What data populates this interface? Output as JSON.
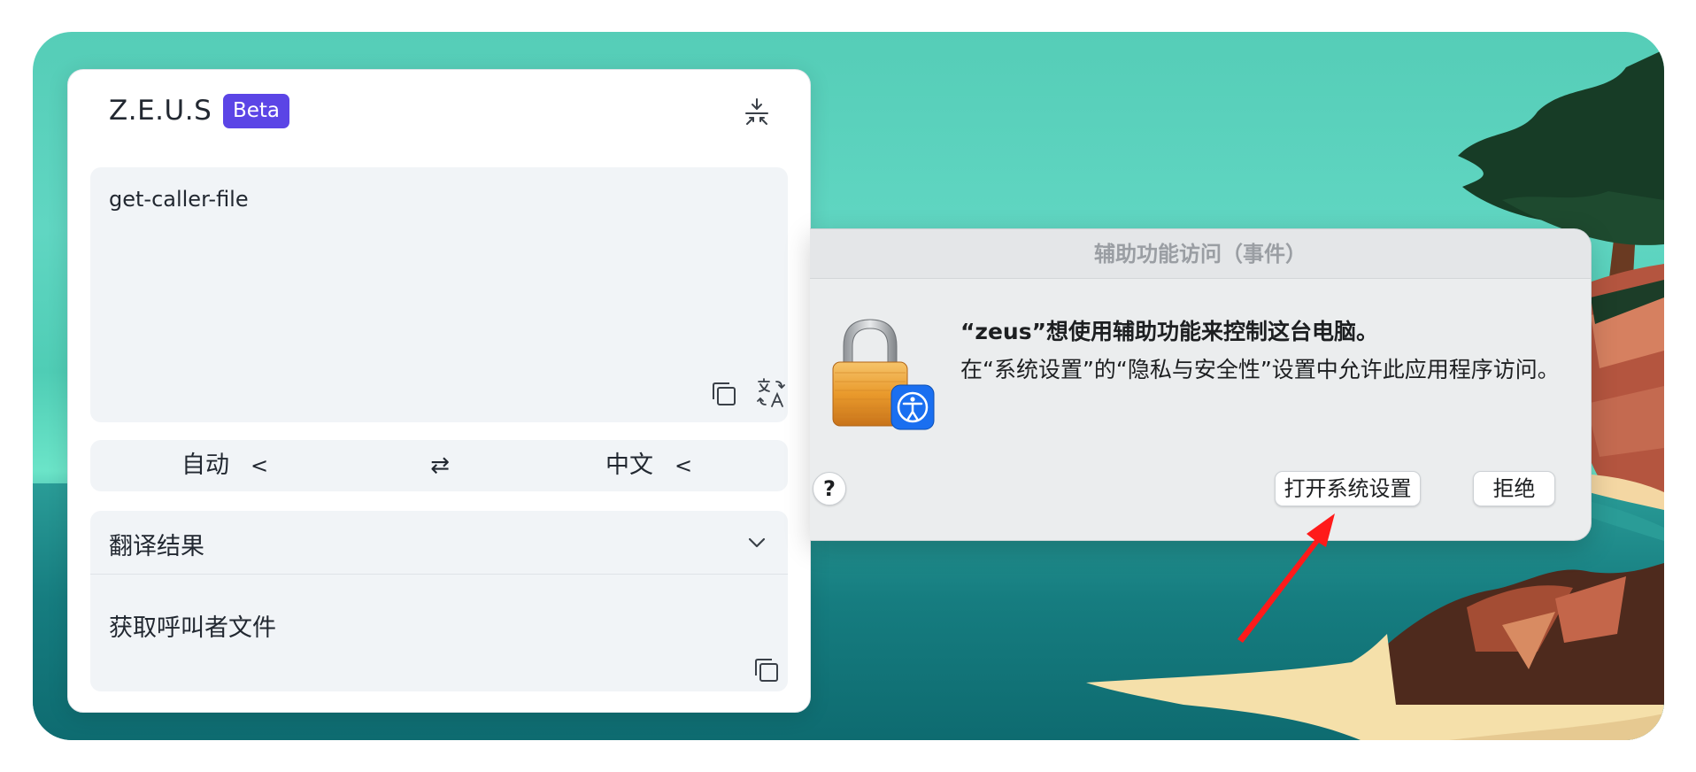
{
  "zeus_panel": {
    "title": "Z.E.U.S",
    "badge": "Beta",
    "source_text": "get-caller-file",
    "source_lang": "自动",
    "target_lang": "中文",
    "swap_symbol": "⇄",
    "chevron_symbol": "<",
    "result_header": "翻译结果",
    "result_text": "获取呼叫者文件",
    "icons": [
      "collapse-icon",
      "copy-icon",
      "translate-icon",
      "swap-icon",
      "chevron-left-icon",
      "chevron-down-icon"
    ]
  },
  "permission_dialog": {
    "title": "辅助功能访问（事件）",
    "heading": "“zeus”想使用辅助功能来控制这台电脑。",
    "body": "在“系统设置”的“隐私与安全性”设置中允许此应用程序访问。",
    "help_label": "?",
    "open_settings_label": "打开系统设置",
    "deny_label": "拒绝",
    "icons": [
      "lock-icon",
      "accessibility-icon",
      "help-icon"
    ]
  },
  "colors": {
    "beta_badge": "#5b45e6",
    "panel_field": "#f1f4f7",
    "dialog_bg": "#ebedee",
    "accessibility_blue": "#1a6ff0",
    "annotation_arrow": "#ff1a1a"
  }
}
